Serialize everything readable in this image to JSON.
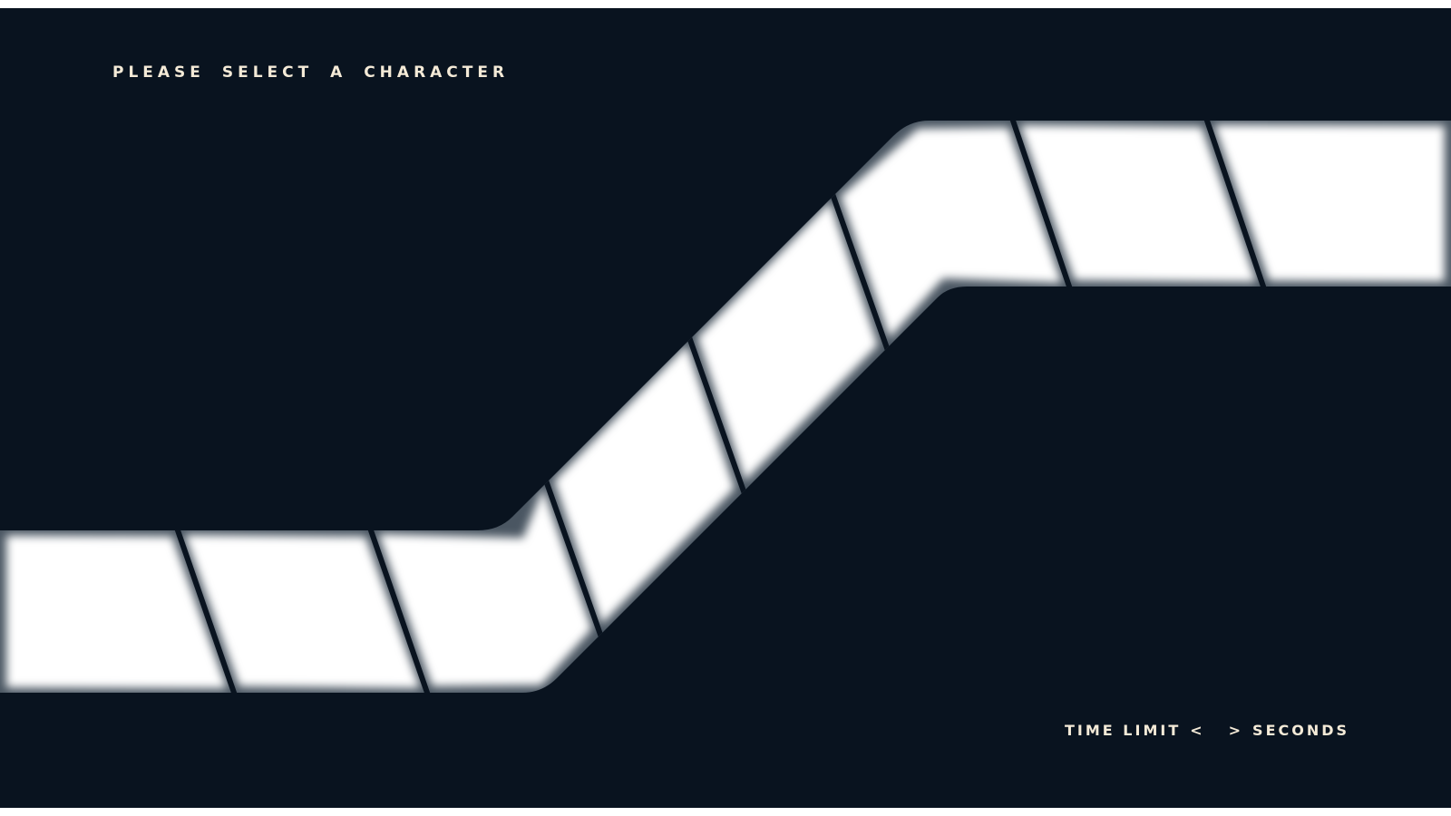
{
  "screen": {
    "title": "PLEASE SELECT A CHARACTER",
    "background_color": "#09131f",
    "panel_color": "#ffffff",
    "text_color": "#f4ead7"
  },
  "character_slots": [
    {
      "name": "",
      "state": "empty"
    },
    {
      "name": "",
      "state": "empty"
    },
    {
      "name": "",
      "state": "empty"
    },
    {
      "name": "",
      "state": "empty"
    },
    {
      "name": "",
      "state": "empty"
    },
    {
      "name": "",
      "state": "empty"
    },
    {
      "name": "",
      "state": "empty"
    },
    {
      "name": "",
      "state": "empty"
    },
    {
      "name": "",
      "state": "empty"
    }
  ],
  "time_limit": {
    "label": "TIME LIMIT",
    "decrease_glyph": "<",
    "value": "",
    "increase_glyph": ">",
    "unit": "SECONDS"
  }
}
